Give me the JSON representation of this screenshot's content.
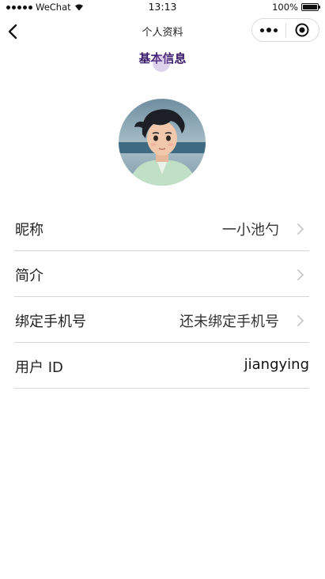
{
  "status_bar": {
    "carrier": "WeChat",
    "time": "13:13",
    "battery": "100%"
  },
  "nav": {
    "title": "个人资料"
  },
  "section": {
    "title": "基本信息"
  },
  "profile": {
    "rows": [
      {
        "label": "昵称",
        "value": "一小池勺",
        "has_arrow": true
      },
      {
        "label": "简介",
        "value": "",
        "has_arrow": true
      },
      {
        "label": "绑定手机号",
        "value": "还未绑定手机号",
        "has_arrow": true
      },
      {
        "label": "用户 ID",
        "value": "jiangying",
        "has_arrow": false
      }
    ]
  },
  "colors": {
    "section_title": "#3a1a6b",
    "divider": "#d6d6d6",
    "arrow": "#c8c8c8"
  }
}
